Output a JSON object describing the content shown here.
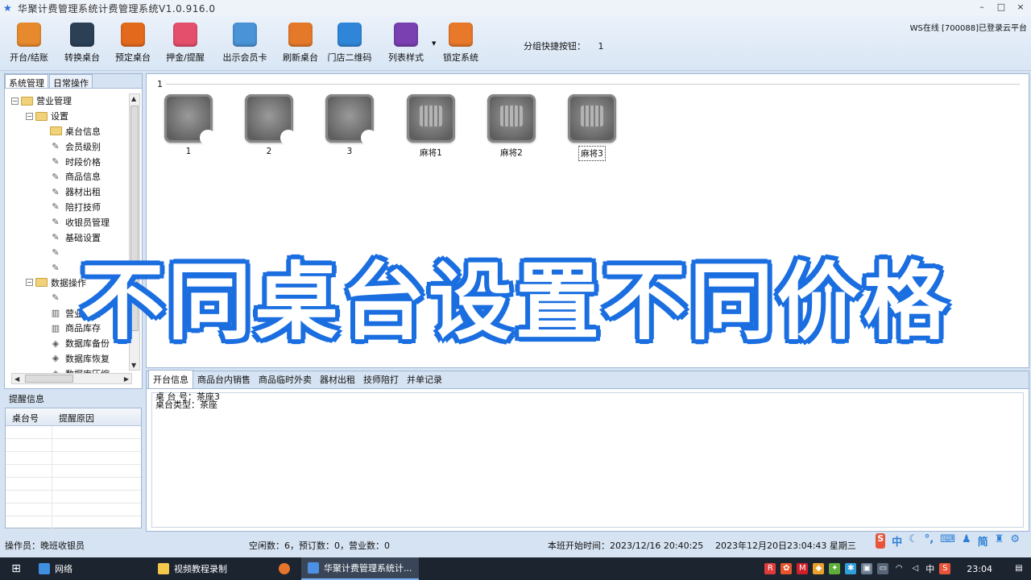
{
  "window": {
    "title": "华聚计费管理系统计费管理系统V1.0.916.0",
    "controls": [
      "–",
      "□",
      "×"
    ]
  },
  "toolbar": {
    "buttons": [
      {
        "label": "开台/结账",
        "icon": "open-close-icon",
        "color": "#e78a2d"
      },
      {
        "label": "转换桌台",
        "icon": "layers-icon",
        "color": "#2b3f55"
      },
      {
        "label": "预定桌台",
        "icon": "tag-icon",
        "color": "#e36a1c"
      },
      {
        "label": "押金/提醒",
        "icon": "chat-bubble-icon",
        "color": "#e44f6c"
      },
      {
        "label": "出示会员卡",
        "icon": "member-card-icon",
        "color": "#4a93d6"
      },
      {
        "label": "刷新桌台",
        "icon": "refresh-compass-icon",
        "color": "#e5792a"
      },
      {
        "label": "门店二维码",
        "icon": "qr-code-icon",
        "color": "#2f86d9"
      },
      {
        "label": "列表样式",
        "icon": "palette-icon",
        "color": "#7a3fb0"
      },
      {
        "label": "锁定系统",
        "icon": "lock-icon",
        "color": "#e8782a"
      }
    ],
    "group_quick_label": "分组快捷按钮：",
    "group_quick_value": "1",
    "online_status": "WS在线 [700088]已登录云平台"
  },
  "left_panel": {
    "tabs": [
      "系统管理",
      "日常操作"
    ],
    "tree": [
      {
        "level": 0,
        "type": "folder",
        "label": "营业管理",
        "expand": "⊟"
      },
      {
        "level": 1,
        "type": "folder",
        "label": "设置",
        "expand": "⊟"
      },
      {
        "level": 2,
        "type": "folder",
        "label": "桌台信息"
      },
      {
        "level": 2,
        "type": "leaf",
        "label": "会员级别"
      },
      {
        "level": 2,
        "type": "leaf",
        "label": "时段价格"
      },
      {
        "level": 2,
        "type": "leaf",
        "label": "商品信息"
      },
      {
        "level": 2,
        "type": "leaf",
        "label": "器材出租"
      },
      {
        "level": 2,
        "type": "leaf",
        "label": "陪打技师"
      },
      {
        "level": 2,
        "type": "leaf",
        "label": "收银员管理"
      },
      {
        "level": 2,
        "type": "leaf",
        "label": "基础设置"
      },
      {
        "level": 2,
        "type": "leaf",
        "label": ""
      },
      {
        "level": 2,
        "type": "leaf",
        "label": ""
      },
      {
        "level": 1,
        "type": "folder",
        "label": "数据操作",
        "expand": "⊟"
      },
      {
        "level": 2,
        "type": "leaf",
        "label": ""
      },
      {
        "level": 2,
        "type": "grid",
        "label": "营业数据"
      },
      {
        "level": 2,
        "type": "grid",
        "label": "商品库存"
      },
      {
        "level": 2,
        "type": "box",
        "label": "数据库备份"
      },
      {
        "level": 2,
        "type": "box",
        "label": "数据库恢复"
      },
      {
        "level": 2,
        "type": "box",
        "label": "数据库压缩"
      }
    ]
  },
  "remind": {
    "title": "提醒信息",
    "columns": [
      "桌台号",
      "提醒原因"
    ]
  },
  "tables": {
    "group": "1",
    "items": [
      {
        "name": "1",
        "kind": "plain"
      },
      {
        "name": "2",
        "kind": "plain"
      },
      {
        "name": "3",
        "kind": "plain"
      },
      {
        "name": "麻将1",
        "kind": "mahjong"
      },
      {
        "name": "麻将2",
        "kind": "mahjong"
      },
      {
        "name": "麻将3",
        "kind": "mahjong",
        "selected": true
      }
    ]
  },
  "bottom": {
    "tabs": [
      "开台信息",
      "商品台内销售",
      "商品临时外卖",
      "器材出租",
      "技师陪打",
      "并单记录"
    ],
    "info": [
      {
        "label": "桌 台 号：",
        "value": "茶座3"
      },
      {
        "label": "桌台类型：",
        "value": "茶座"
      }
    ]
  },
  "overlay_caption": "不同桌台设置不同价格",
  "status": {
    "operator": "操作员：晚班收银员",
    "counts": "空闲数：6，预订数：0，营业数：0",
    "shift_start": "本班开始时间：2023/12/16 20:40:25",
    "now": "2023年12月20日23:04:43 星期三"
  },
  "ime": [
    "中",
    "简"
  ],
  "taskbar": {
    "items": [
      "网络",
      "视频教程录制",
      "华聚计费管理系统计..."
    ],
    "clock": "23:04",
    "ime": "中"
  }
}
